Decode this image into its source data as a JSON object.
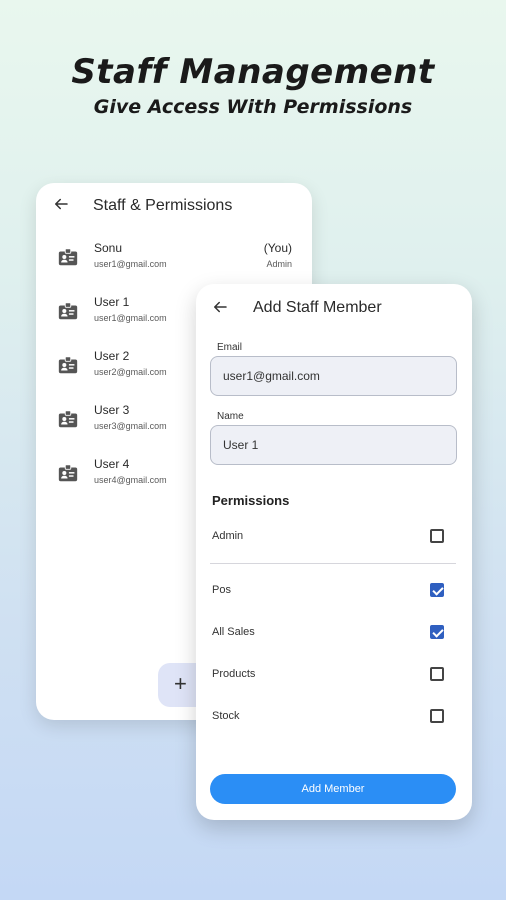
{
  "promo": {
    "headline": "Staff Management",
    "subline": "Give Access With Permissions"
  },
  "staff_screen": {
    "title": "Staff & Permissions",
    "back_icon": "arrow-left-icon",
    "add_button_label": "+",
    "staff": [
      {
        "name": "Sonu",
        "email": "user1@gmail.com",
        "tag": "(You)",
        "role": "Admin"
      },
      {
        "name": "User 1",
        "email": "user1@gmail.com"
      },
      {
        "name": "User 2",
        "email": "user2@gmail.com"
      },
      {
        "name": "User 3",
        "email": "user3@gmail.com"
      },
      {
        "name": "User 4",
        "email": "user4@gmail.com"
      }
    ]
  },
  "add_screen": {
    "title": "Add Staff Member",
    "back_icon": "arrow-left-icon",
    "email_label": "Email",
    "email_value": "user1@gmail.com",
    "name_label": "Name",
    "name_value": "User 1",
    "permissions_heading": "Permissions",
    "permissions": [
      {
        "label": "Admin",
        "checked": false
      },
      {
        "label": "Pos",
        "checked": true
      },
      {
        "label": "All Sales",
        "checked": true
      },
      {
        "label": "Products",
        "checked": false
      },
      {
        "label": "Stock",
        "checked": false
      }
    ],
    "submit_label": "Add Member"
  },
  "colors": {
    "accent": "#2b8ef5",
    "checkbox_checked": "#2f5fc0"
  }
}
